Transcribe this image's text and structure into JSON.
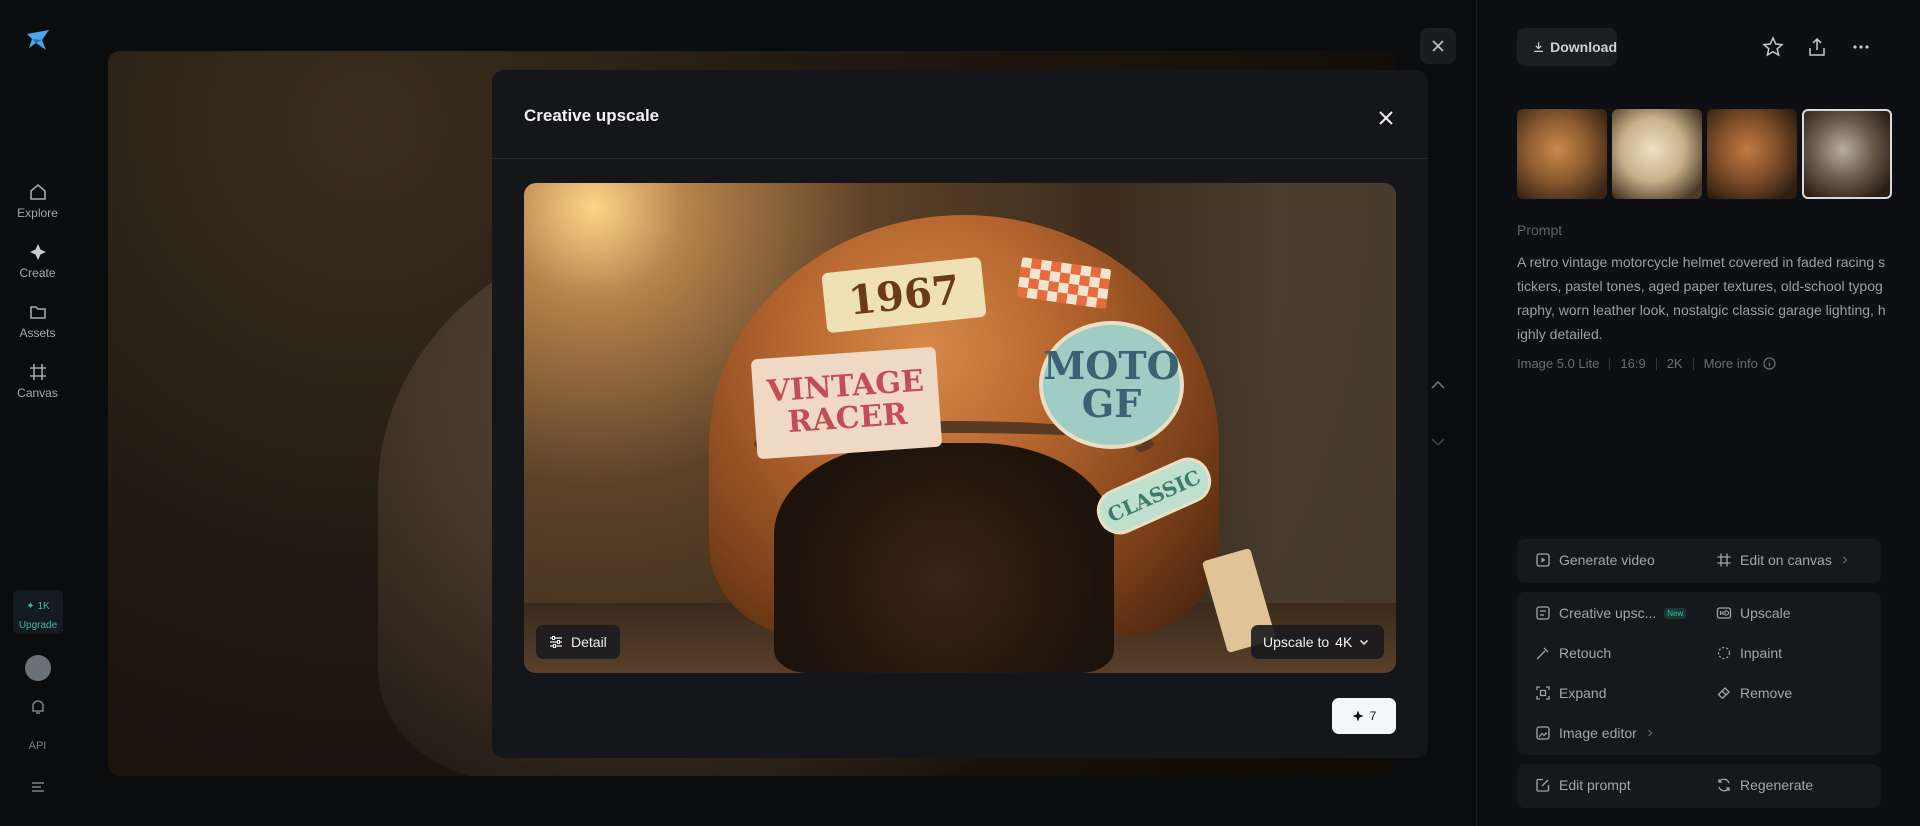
{
  "nav": {
    "items": [
      {
        "label": "Explore",
        "icon": "home-icon"
      },
      {
        "label": "Create",
        "icon": "sparkle-icon"
      },
      {
        "label": "Assets",
        "icon": "folder-icon"
      },
      {
        "label": "Canvas",
        "icon": "canvas-icon"
      }
    ],
    "credits_value": "✦ 1K",
    "upgrade_label": "Upgrade",
    "api_label": "API"
  },
  "panel": {
    "download_label": "Download",
    "prompt_title": "Prompt",
    "prompt_text": "A retro vintage motorcycle helmet covered in faded racing stickers, pastel tones, aged paper textures, old-school typography, worn leather look, nostalgic classic garage lighting, highly detailed.",
    "meta": {
      "model": "Image 5.0 Lite",
      "ratio": "16:9",
      "resolution": "2K",
      "more_info": "More info"
    },
    "actions": {
      "generate_video": "Generate video",
      "edit_on_canvas": "Edit on canvas",
      "creative_upscale": "Creative upsc...",
      "new_badge": "New",
      "upscale": "Upscale",
      "retouch": "Retouch",
      "inpaint": "Inpaint",
      "expand": "Expand",
      "remove": "Remove",
      "image_editor": "Image editor",
      "edit_prompt": "Edit prompt",
      "regenerate": "Regenerate"
    }
  },
  "modal": {
    "title": "Creative upscale",
    "detail_label": "Detail",
    "upscale_to_label": "Upscale to",
    "upscale_value": "4K",
    "run_cost": "7",
    "image": {
      "stickers": {
        "year": "1967",
        "vintage_racer": "VINTAGE RACER",
        "moto_gf": "MOTO GF",
        "classic": "CLASSIC"
      }
    }
  },
  "colors": {
    "background": "#0b0c0e",
    "modal_bg": "#15161a",
    "accent": "#3fb7a8",
    "run_button": "#f5f6f8"
  }
}
